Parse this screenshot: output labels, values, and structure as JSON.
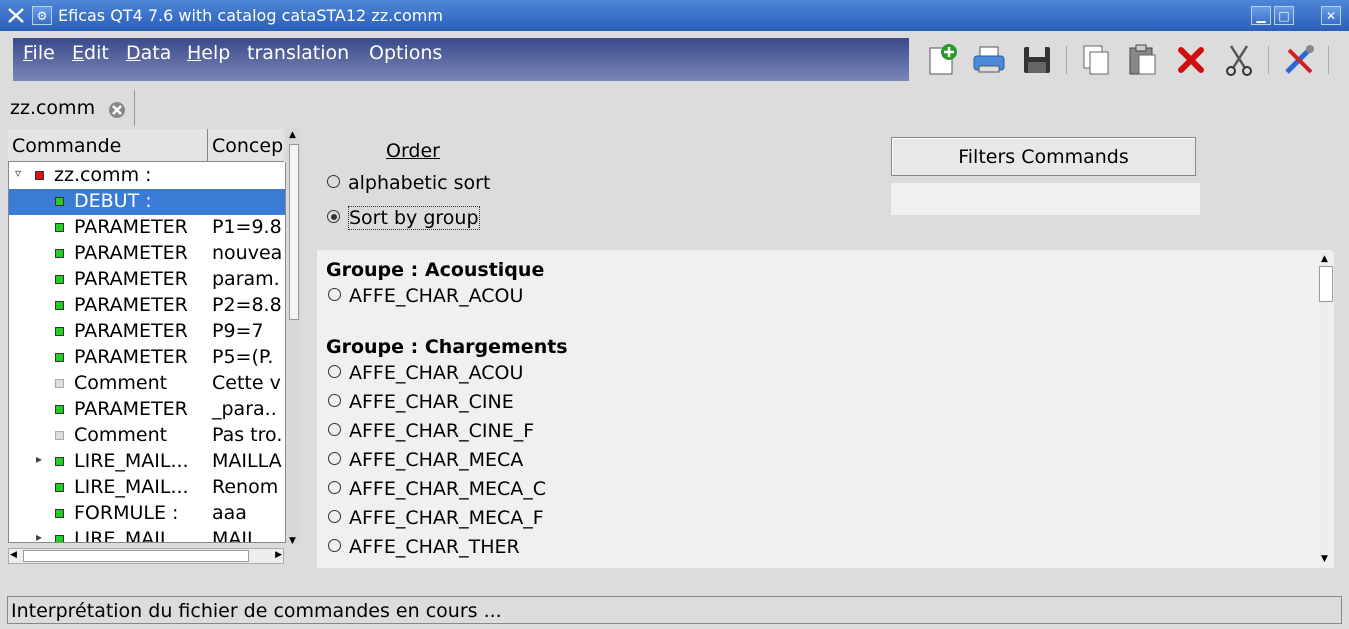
{
  "window": {
    "title": "Eficas QT4 7.6 with catalog  cataSTA12 zz.comm"
  },
  "menu": [
    {
      "underline": "F",
      "rest": "ile"
    },
    {
      "underline": "E",
      "rest": "dit"
    },
    {
      "underline": "D",
      "rest": "ata"
    },
    {
      "underline": "H",
      "rest": "elp"
    },
    {
      "underline": "",
      "rest": "translation"
    },
    {
      "underline": "",
      "rest": "Options"
    }
  ],
  "tab": {
    "label": "zz.comm"
  },
  "tree": {
    "headers": {
      "col1": "Commande",
      "col2": "Concep"
    },
    "rows": [
      {
        "arrow": "▿",
        "icon": "red",
        "c1": "zz.comm :",
        "c2": "",
        "indent": "root"
      },
      {
        "arrow": "",
        "icon": "green",
        "c1": "DEBUT :",
        "c2": "",
        "selected": true
      },
      {
        "arrow": "",
        "icon": "green",
        "c1": "PARAMETER",
        "c2": "P1=9.8"
      },
      {
        "arrow": "",
        "icon": "green",
        "c1": "PARAMETER",
        "c2": "nouvea"
      },
      {
        "arrow": "",
        "icon": "green",
        "c1": "PARAMETER",
        "c2": "param."
      },
      {
        "arrow": "",
        "icon": "green",
        "c1": "PARAMETER",
        "c2": "P2=8.8"
      },
      {
        "arrow": "",
        "icon": "green",
        "c1": "PARAMETER",
        "c2": "P9=7"
      },
      {
        "arrow": "",
        "icon": "green",
        "c1": "PARAMETER",
        "c2": "P5=(P."
      },
      {
        "arrow": "",
        "icon": "gray",
        "c1": "Comment",
        "c2": "Cette v"
      },
      {
        "arrow": "",
        "icon": "green",
        "c1": "PARAMETER",
        "c2": "_para.."
      },
      {
        "arrow": "",
        "icon": "gray",
        "c1": "Comment",
        "c2": "Pas tro."
      },
      {
        "arrow": "▸",
        "icon": "green",
        "c1": "LIRE_MAIL...",
        "c2": "MAILLA"
      },
      {
        "arrow": "",
        "icon": "green",
        "c1": "LIRE_MAIL...",
        "c2": "Renom"
      },
      {
        "arrow": "",
        "icon": "green",
        "c1": "FORMULE :",
        "c2": "aaa"
      },
      {
        "arrow": "▸",
        "icon": "green",
        "c1": "LIRE_MAIL...",
        "c2": "MAIL"
      }
    ]
  },
  "order": {
    "title": "Order",
    "options": [
      {
        "label": "alphabetic sort",
        "checked": false
      },
      {
        "label": "Sort by group",
        "checked": true
      }
    ]
  },
  "filters": {
    "button_label": "Filters Commands",
    "value": ""
  },
  "groups": [
    {
      "title": "Groupe : Acoustique",
      "commands": [
        "AFFE_CHAR_ACOU"
      ]
    },
    {
      "title": "Groupe : Chargements",
      "commands": [
        "AFFE_CHAR_ACOU",
        "AFFE_CHAR_CINE",
        "AFFE_CHAR_CINE_F",
        "AFFE_CHAR_MECA",
        "AFFE_CHAR_MECA_C",
        "AFFE_CHAR_MECA_F",
        "AFFE_CHAR_THER"
      ]
    }
  ],
  "status": {
    "text": "Interprétation du fichier de commandes en cours ..."
  },
  "icons": [
    "new-file-icon",
    "print-icon",
    "save-icon",
    "copy-icon",
    "paste-icon",
    "delete-icon",
    "cut-icon",
    "tools-icon"
  ]
}
